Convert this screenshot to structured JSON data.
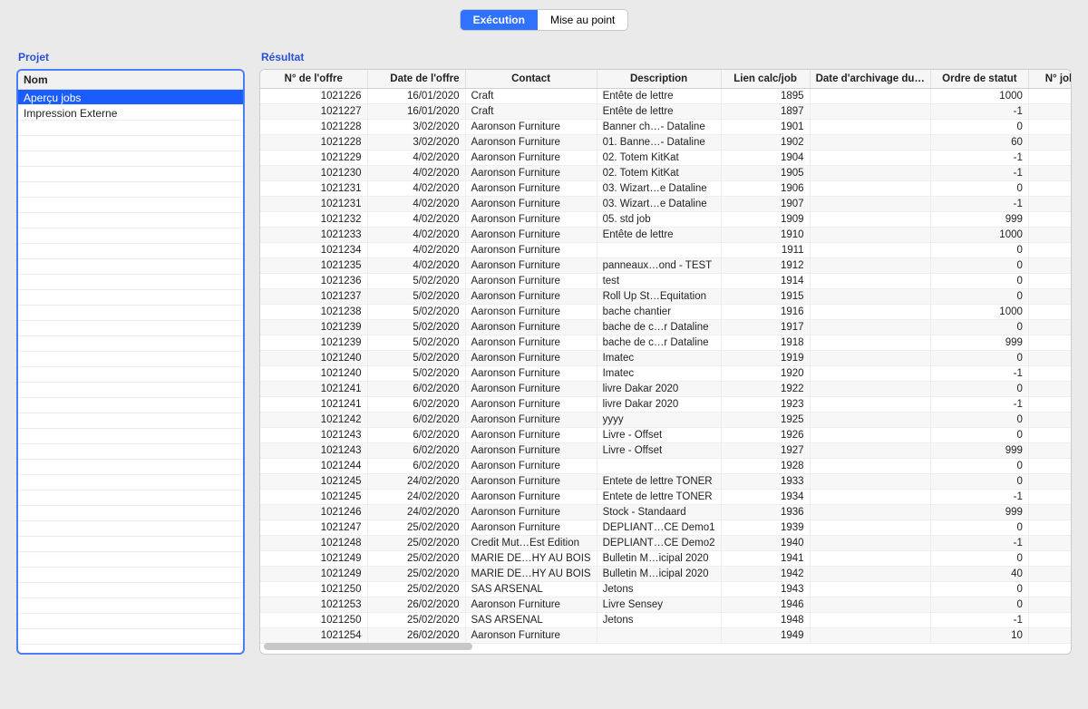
{
  "toolbar": {
    "execution_label": "Exécution",
    "debug_label": "Mise au point"
  },
  "panels": {
    "projet": "Projet",
    "resultat": "Résultat"
  },
  "project_list": {
    "header": "Nom",
    "items": [
      {
        "label": "Aperçu jobs",
        "selected": true
      },
      {
        "label": "Impression Externe",
        "selected": false
      }
    ]
  },
  "columns": [
    "N° de l'offre",
    "Date de l'offre",
    "Contact",
    "Description",
    "Lien calc/job",
    "Date d'archivage du…",
    "Ordre de statut",
    "N° job"
  ],
  "rows": [
    {
      "offre": "1021226",
      "date": "16/01/2020",
      "contact": "Craft",
      "desc": "Entête de lettre",
      "lien": "1895",
      "arch": "",
      "statut": "1000"
    },
    {
      "offre": "1021227",
      "date": "16/01/2020",
      "contact": "Craft",
      "desc": "Entête de lettre",
      "lien": "1897",
      "arch": "",
      "statut": "-1"
    },
    {
      "offre": "1021228",
      "date": "3/02/2020",
      "contact": "Aaronson Furniture",
      "desc": "Banner ch…- Dataline",
      "lien": "1901",
      "arch": "",
      "statut": "0"
    },
    {
      "offre": "1021228",
      "date": "3/02/2020",
      "contact": "Aaronson Furniture",
      "desc": "01. Banne…- Dataline",
      "lien": "1902",
      "arch": "",
      "statut": "60"
    },
    {
      "offre": "1021229",
      "date": "4/02/2020",
      "contact": "Aaronson Furniture",
      "desc": "02. Totem KitKat",
      "lien": "1904",
      "arch": "",
      "statut": "-1"
    },
    {
      "offre": "1021230",
      "date": "4/02/2020",
      "contact": "Aaronson Furniture",
      "desc": "02. Totem KitKat",
      "lien": "1905",
      "arch": "",
      "statut": "-1"
    },
    {
      "offre": "1021231",
      "date": "4/02/2020",
      "contact": "Aaronson Furniture",
      "desc": "03. Wizart…e Dataline",
      "lien": "1906",
      "arch": "",
      "statut": "0"
    },
    {
      "offre": "1021231",
      "date": "4/02/2020",
      "contact": "Aaronson Furniture",
      "desc": "03. Wizart…e Dataline",
      "lien": "1907",
      "arch": "",
      "statut": "-1"
    },
    {
      "offre": "1021232",
      "date": "4/02/2020",
      "contact": "Aaronson Furniture",
      "desc": "05. std job",
      "lien": "1909",
      "arch": "",
      "statut": "999"
    },
    {
      "offre": "1021233",
      "date": "4/02/2020",
      "contact": "Aaronson Furniture",
      "desc": "Entête de lettre",
      "lien": "1910",
      "arch": "",
      "statut": "1000"
    },
    {
      "offre": "1021234",
      "date": "4/02/2020",
      "contact": "Aaronson Furniture",
      "desc": "",
      "lien": "1911",
      "arch": "",
      "statut": "0"
    },
    {
      "offre": "1021235",
      "date": "4/02/2020",
      "contact": "Aaronson Furniture",
      "desc": "panneaux…ond - TEST",
      "lien": "1912",
      "arch": "",
      "statut": "0"
    },
    {
      "offre": "1021236",
      "date": "5/02/2020",
      "contact": "Aaronson Furniture",
      "desc": "test",
      "lien": "1914",
      "arch": "",
      "statut": "0"
    },
    {
      "offre": "1021237",
      "date": "5/02/2020",
      "contact": "Aaronson Furniture",
      "desc": "Roll Up St…Equitation",
      "lien": "1915",
      "arch": "",
      "statut": "0"
    },
    {
      "offre": "1021238",
      "date": "5/02/2020",
      "contact": "Aaronson Furniture",
      "desc": "bache chantier",
      "lien": "1916",
      "arch": "",
      "statut": "1000"
    },
    {
      "offre": "1021239",
      "date": "5/02/2020",
      "contact": "Aaronson Furniture",
      "desc": "bache de c…r Dataline",
      "lien": "1917",
      "arch": "",
      "statut": "0"
    },
    {
      "offre": "1021239",
      "date": "5/02/2020",
      "contact": "Aaronson Furniture",
      "desc": "bache de c…r Dataline",
      "lien": "1918",
      "arch": "",
      "statut": "999"
    },
    {
      "offre": "1021240",
      "date": "5/02/2020",
      "contact": "Aaronson Furniture",
      "desc": "Imatec",
      "lien": "1919",
      "arch": "",
      "statut": "0"
    },
    {
      "offre": "1021240",
      "date": "5/02/2020",
      "contact": "Aaronson Furniture",
      "desc": "Imatec",
      "lien": "1920",
      "arch": "",
      "statut": "-1"
    },
    {
      "offre": "1021241",
      "date": "6/02/2020",
      "contact": "Aaronson Furniture",
      "desc": "livre Dakar 2020",
      "lien": "1922",
      "arch": "",
      "statut": "0"
    },
    {
      "offre": "1021241",
      "date": "6/02/2020",
      "contact": "Aaronson Furniture",
      "desc": "livre Dakar 2020",
      "lien": "1923",
      "arch": "",
      "statut": "-1"
    },
    {
      "offre": "1021242",
      "date": "6/02/2020",
      "contact": "Aaronson Furniture",
      "desc": "yyyy",
      "lien": "1925",
      "arch": "",
      "statut": "0"
    },
    {
      "offre": "1021243",
      "date": "6/02/2020",
      "contact": "Aaronson Furniture",
      "desc": "Livre - Offset",
      "lien": "1926",
      "arch": "",
      "statut": "0"
    },
    {
      "offre": "1021243",
      "date": "6/02/2020",
      "contact": "Aaronson Furniture",
      "desc": "Livre - Offset",
      "lien": "1927",
      "arch": "",
      "statut": "999"
    },
    {
      "offre": "1021244",
      "date": "6/02/2020",
      "contact": "Aaronson Furniture",
      "desc": "",
      "lien": "1928",
      "arch": "",
      "statut": "0"
    },
    {
      "offre": "1021245",
      "date": "24/02/2020",
      "contact": "Aaronson Furniture",
      "desc": "Entete de lettre TONER",
      "lien": "1933",
      "arch": "",
      "statut": "0"
    },
    {
      "offre": "1021245",
      "date": "24/02/2020",
      "contact": "Aaronson Furniture",
      "desc": "Entete de lettre TONER",
      "lien": "1934",
      "arch": "",
      "statut": "-1"
    },
    {
      "offre": "1021246",
      "date": "24/02/2020",
      "contact": "Aaronson Furniture",
      "desc": "Stock - Standaard",
      "lien": "1936",
      "arch": "",
      "statut": "999"
    },
    {
      "offre": "1021247",
      "date": "25/02/2020",
      "contact": "Aaronson Furniture",
      "desc": "DEPLIANT…CE Demo1",
      "lien": "1939",
      "arch": "",
      "statut": "0"
    },
    {
      "offre": "1021248",
      "date": "25/02/2020",
      "contact": "Credit Mut…Est Edition",
      "desc": "DEPLIANT…CE Demo2",
      "lien": "1940",
      "arch": "",
      "statut": "-1"
    },
    {
      "offre": "1021249",
      "date": "25/02/2020",
      "contact": "MARIE DE…HY AU BOIS",
      "desc": "Bulletin M…icipal 2020",
      "lien": "1941",
      "arch": "",
      "statut": "0"
    },
    {
      "offre": "1021249",
      "date": "25/02/2020",
      "contact": "MARIE DE…HY AU BOIS",
      "desc": "Bulletin M…icipal 2020",
      "lien": "1942",
      "arch": "",
      "statut": "40"
    },
    {
      "offre": "1021250",
      "date": "25/02/2020",
      "contact": "SAS ARSENAL",
      "desc": "Jetons",
      "lien": "1943",
      "arch": "",
      "statut": "0"
    },
    {
      "offre": "1021253",
      "date": "26/02/2020",
      "contact": "Aaronson Furniture",
      "desc": "Livre Sensey",
      "lien": "1946",
      "arch": "",
      "statut": "0"
    },
    {
      "offre": "1021250",
      "date": "25/02/2020",
      "contact": "SAS ARSENAL",
      "desc": "Jetons",
      "lien": "1948",
      "arch": "",
      "statut": "-1"
    },
    {
      "offre": "1021254",
      "date": "26/02/2020",
      "contact": "Aaronson Furniture",
      "desc": "",
      "lien": "1949",
      "arch": "",
      "statut": "10"
    }
  ]
}
